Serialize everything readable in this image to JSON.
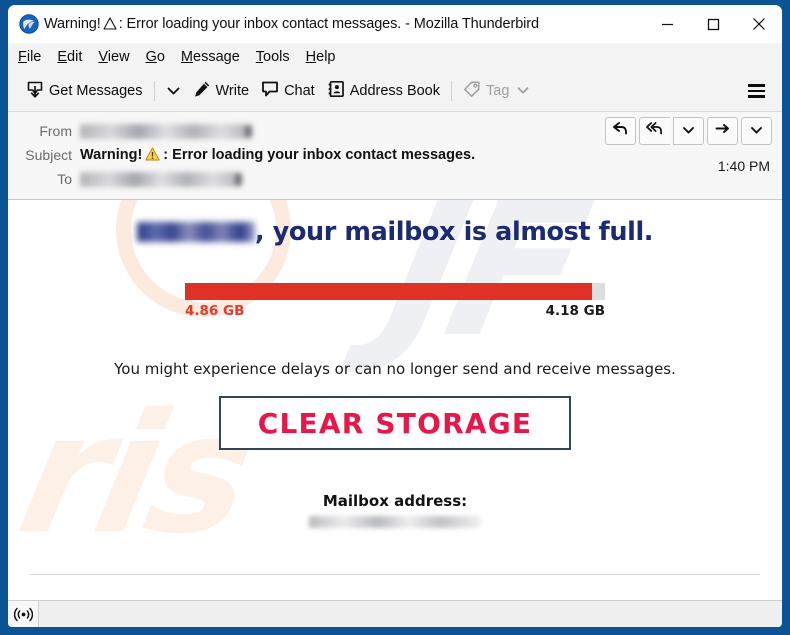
{
  "window": {
    "title": "Warning! ⚠ : Error loading your inbox contact messages. - Mozilla Thunderbird",
    "title_prefix": "Warning!",
    "title_suffix": ": Error loading your inbox contact messages. - Mozilla Thunderbird",
    "app_icon": "thunderbird-icon",
    "controls": {
      "minimize": "minimize-icon",
      "maximize": "maximize-icon",
      "close": "close-icon"
    }
  },
  "menu_bar": {
    "items": [
      {
        "label": "File",
        "accesskey": "F"
      },
      {
        "label": "Edit",
        "accesskey": "E"
      },
      {
        "label": "View",
        "accesskey": "V"
      },
      {
        "label": "Go",
        "accesskey": "G"
      },
      {
        "label": "Message",
        "accesskey": "M"
      },
      {
        "label": "Tools",
        "accesskey": "T"
      },
      {
        "label": "Help",
        "accesskey": "H"
      }
    ]
  },
  "toolbar": {
    "get_messages_label": "Get Messages",
    "get_messages_icon": "download-inbox-icon",
    "get_messages_caret": "chevron-down-icon",
    "write_label": "Write",
    "write_icon": "pencil-icon",
    "chat_label": "Chat",
    "chat_icon": "speech-bubble-icon",
    "address_book_label": "Address Book",
    "address_book_icon": "address-book-icon",
    "tag_label": "Tag",
    "tag_icon": "tag-icon",
    "tag_caret": "chevron-down-icon",
    "tag_disabled": true,
    "menu_icon": "hamburger-menu-icon"
  },
  "message_header": {
    "from_label": "From",
    "from_value": "",
    "from_redacted": true,
    "subject_label": "Subject",
    "subject_prefix": "Warning!",
    "subject_suffix": ": Error loading your inbox contact messages.",
    "subject_warning_icon": "warning-triangle-icon",
    "to_label": "To",
    "to_value": "",
    "to_redacted": true,
    "time": "1:40 PM",
    "actions": [
      {
        "name": "reply-button",
        "icon": "reply-arrow-icon"
      },
      {
        "name": "reply-all-button",
        "icon": "reply-all-arrow-icon"
      },
      {
        "name": "reply-options-button",
        "icon": "chevron-down-icon"
      },
      {
        "name": "forward-button",
        "icon": "forward-arrow-icon"
      },
      {
        "name": "more-actions-button",
        "icon": "chevron-down-icon"
      }
    ]
  },
  "mail_body": {
    "headline_domain_redacted": true,
    "headline_text": ", your mailbox is almost full.",
    "storage": {
      "used_label": "4.86 GB",
      "free_label": "4.18 GB",
      "fill_percent": 97,
      "fill_color": "#e03127",
      "track_color": "#dedede"
    },
    "warning_text": "You might experience delays or can no longer send and receive messages.",
    "cta_label": "CLEAR STORAGE",
    "cta_text_color": "#e8174a",
    "cta_border_color": "#2f4858",
    "mailbox_title": "Mailbox address:",
    "mailbox_value": "",
    "mailbox_redacted": true,
    "watermark_top": "JF",
    "watermark_bottom": "ris"
  },
  "status_bar": {
    "icon": "broadcast-signal-icon",
    "text": ""
  },
  "colors": {
    "window_border": "#0b5394",
    "headline": "#1c2a72",
    "accent_red": "#e03127",
    "cta_red": "#e8174a",
    "toolbar_bg": "#f3f3f3",
    "header_bg": "#f7f7f7"
  }
}
